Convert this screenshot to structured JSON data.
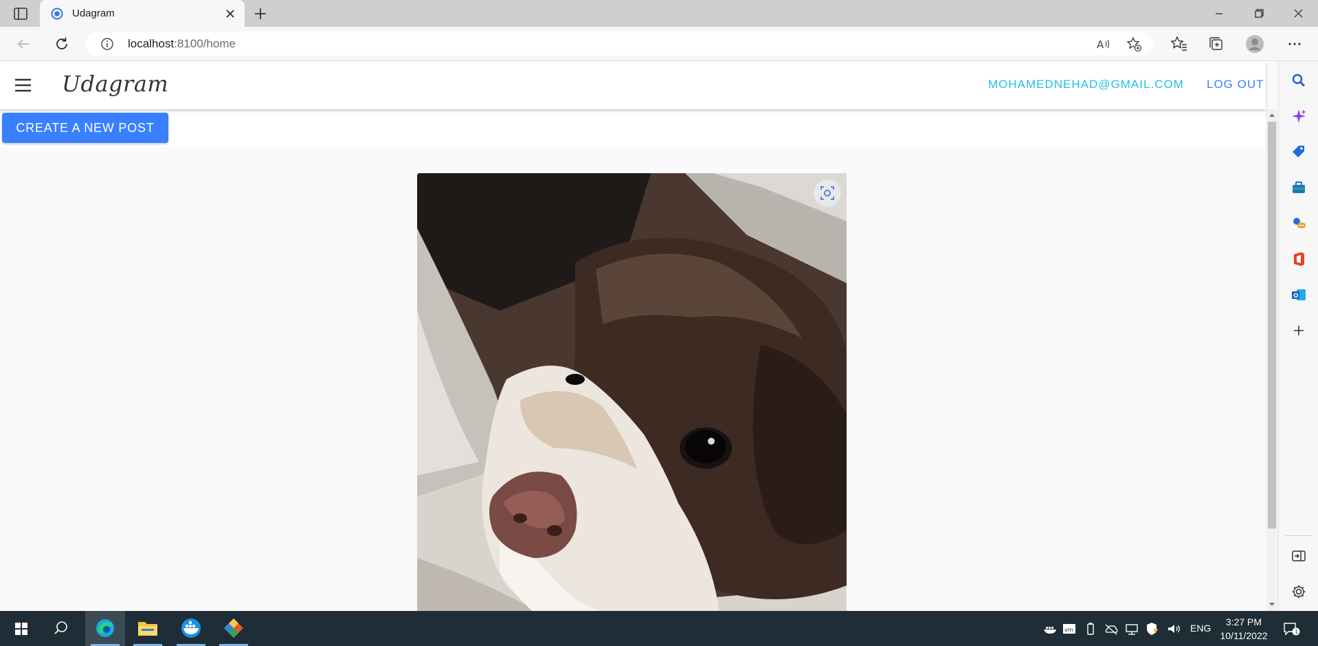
{
  "browser": {
    "tab_title": "Udagram",
    "url_host": "localhost",
    "url_rest": ":8100/home"
  },
  "app": {
    "logo": "Udagram",
    "user_email": "MOHAMEDNEHAD@GMAIL.COM",
    "logout_label": "LOG OUT",
    "create_post_label": "CREATE A NEW POST",
    "accent_color": "#3880ff",
    "email_color": "#22bfe6"
  },
  "feed": {
    "items": [
      {
        "image": "dog-photo"
      }
    ]
  },
  "taskbar": {
    "language": "ENG",
    "time": "3:27 PM",
    "date": "10/11/2022"
  }
}
